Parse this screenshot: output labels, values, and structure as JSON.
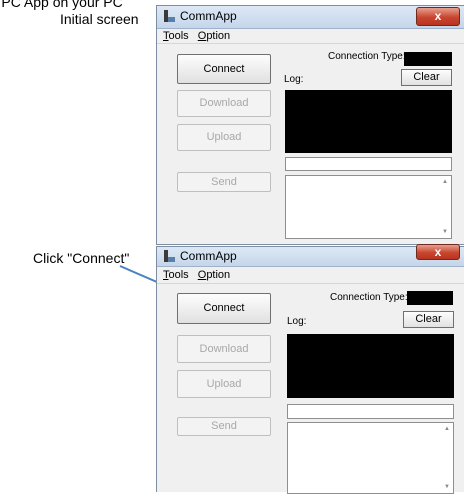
{
  "captions": {
    "top_line": "the PC App on your PC",
    "initial_screen": "Initial screen",
    "click_connect": "Click \"Connect\""
  },
  "app": {
    "title": "CommApp",
    "close_glyph": "x",
    "menu": {
      "tools": {
        "mnemonic": "T",
        "rest": "ools"
      },
      "option": {
        "mnemonic": "O",
        "rest": "ption"
      }
    },
    "buttons": {
      "connect": "Connect",
      "download": "Download",
      "upload": "Upload",
      "send": "Send",
      "clear": "Clear"
    },
    "connection_type_label": "Connection Type:",
    "log_label": "Log:"
  },
  "icons": {
    "app_icon": "app-window-icon",
    "close": "close-icon",
    "arrow": "pointer-arrow"
  },
  "colors": {
    "arrow": "#4a7fc1",
    "log_bg": "#000000",
    "close_bg": "#c8452f"
  }
}
